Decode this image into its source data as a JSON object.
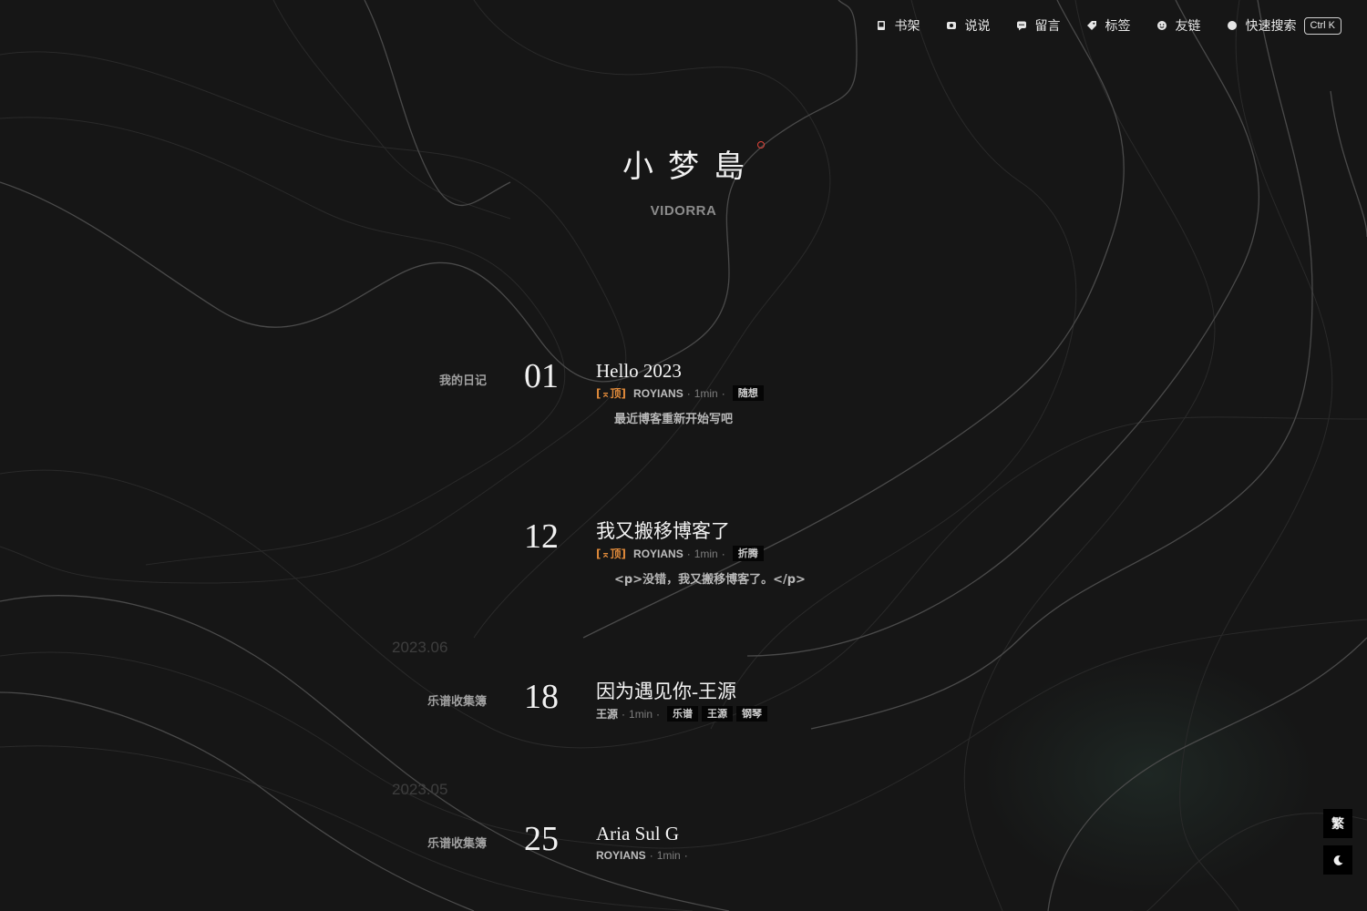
{
  "nav": {
    "items": [
      {
        "label": "书架",
        "icon": "book-icon"
      },
      {
        "label": "说说",
        "icon": "camera-icon"
      },
      {
        "label": "留言",
        "icon": "chat-bubble-icon"
      },
      {
        "label": "标签",
        "icon": "tag-icon"
      },
      {
        "label": "友链",
        "icon": "smile-icon"
      },
      {
        "label": "快速搜索",
        "icon": "search-dot-icon"
      }
    ],
    "search_shortcut": "Ctrl K"
  },
  "site": {
    "logo_text": "小梦島",
    "subtitle": "VIDORRA"
  },
  "posts": [
    {
      "category": "我的日记",
      "day": "01",
      "title": "Hello 2023",
      "pinned_label": "[⌅顶]",
      "author": "ROYIANS",
      "readtime": "1min",
      "tags": [
        "随想"
      ],
      "excerpt": "最近博客重新开始写吧"
    },
    {
      "category": "",
      "day": "12",
      "title": "我又搬移博客了",
      "pinned_label": "[⌅顶]",
      "author": "ROYIANS",
      "readtime": "1min",
      "tags": [
        "折腾"
      ],
      "excerpt": "<p>没错，我又搬移博客了。</p>"
    },
    {
      "category": "乐谱收集簿",
      "day": "18",
      "title": "因为遇见你-王源",
      "pinned_label": "",
      "author": "王源",
      "readtime": "1min",
      "tags": [
        "乐谱",
        "王源",
        "钢琴"
      ],
      "excerpt": ""
    },
    {
      "category": "乐谱收集簿",
      "day": "25",
      "title": "Aria Sul G",
      "pinned_label": "",
      "author": "ROYIANS",
      "readtime": "1min",
      "tags": [],
      "excerpt": ""
    }
  ],
  "months": [
    "2023.06",
    "2023.05"
  ],
  "floating": {
    "traditional_label": "繁",
    "dark_mode_icon": "moon-icon"
  },
  "colors": {
    "background": "#161616",
    "pin": "#e08a3a",
    "logo_dot": "#e0443a",
    "contour": "#2c2c2c",
    "contour_bright": "#4a4a4a"
  }
}
